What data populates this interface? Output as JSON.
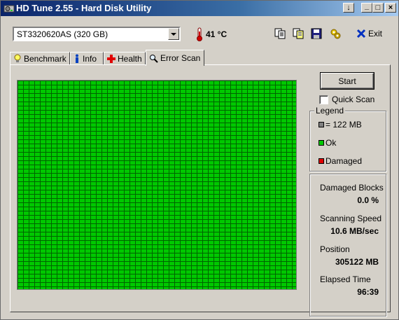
{
  "window": {
    "title": "HD Tune 2.55 - Hard Disk Utility",
    "controls": {
      "menu": "↓",
      "minimize": "_",
      "maximize": "□",
      "close": "×"
    }
  },
  "toolbar": {
    "drive": "ST3320620AS (320 GB)",
    "temperature": "41 °C",
    "exit_label": "Exit",
    "icons": [
      "copy-icon",
      "copy-info-icon",
      "save-icon",
      "options-icon",
      "exit-icon"
    ]
  },
  "tabs": [
    {
      "label": "Benchmark",
      "icon": "benchmark-icon"
    },
    {
      "label": "Info",
      "icon": "info-icon"
    },
    {
      "label": "Health",
      "icon": "health-icon"
    },
    {
      "label": "Error Scan",
      "icon": "magnifier-icon",
      "active": true
    }
  ],
  "scan": {
    "start_label": "Start",
    "quick_scan_label": "Quick Scan",
    "quick_scan_checked": false,
    "legend": {
      "title": "Legend",
      "items": [
        {
          "label": "= 122 MB",
          "color": "#808080"
        },
        {
          "label": "Ok",
          "color": "#00c800"
        },
        {
          "label": "Damaged",
          "color": "#e00000"
        }
      ]
    },
    "stats": {
      "damaged_blocks_label": "Damaged Blocks",
      "damaged_blocks_value": "0.0 %",
      "scanning_speed_label": "Scanning Speed",
      "scanning_speed_value": "10.6 MB/sec",
      "position_label": "Position",
      "position_value": "305122 MB",
      "elapsed_label": "Elapsed Time",
      "elapsed_value": "96:39"
    },
    "block_color": "#00c800"
  }
}
